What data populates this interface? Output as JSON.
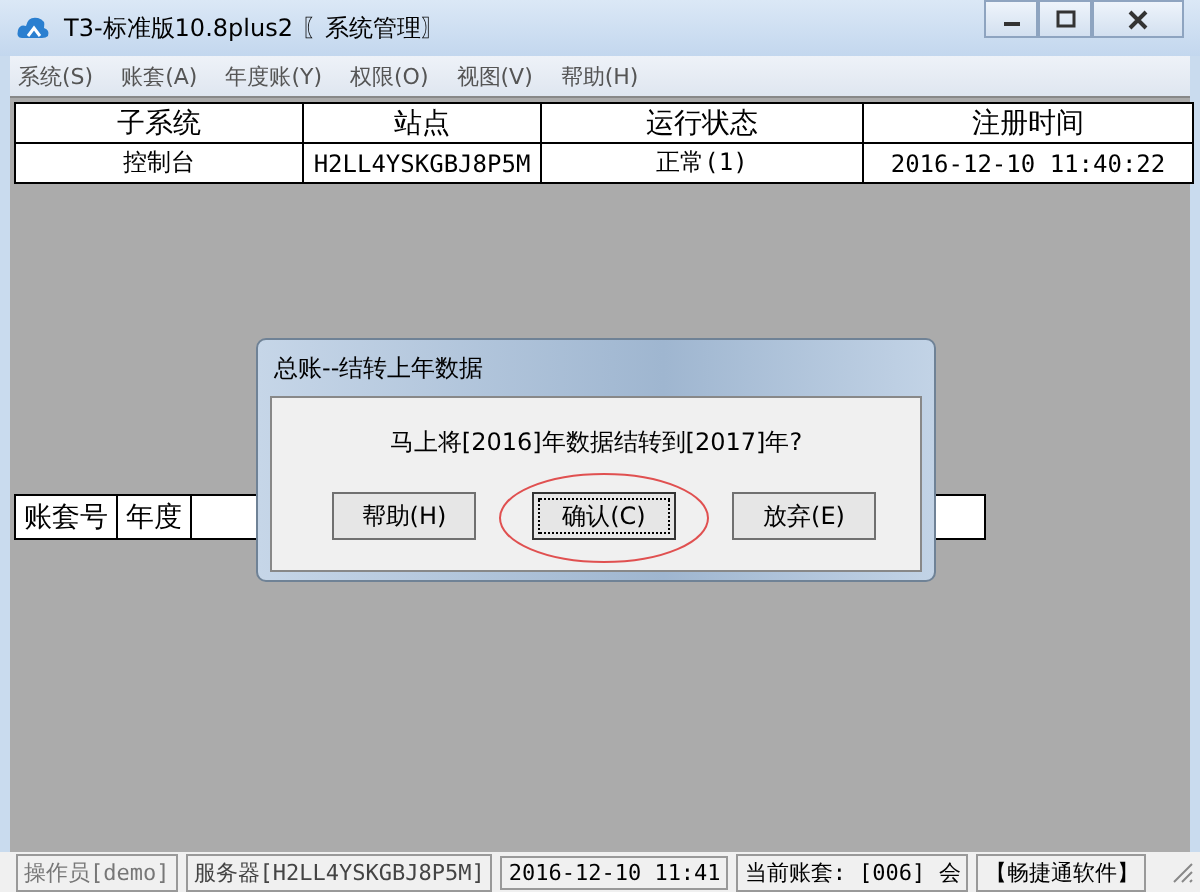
{
  "window": {
    "title": "T3-标准版10.8plus2 〖系统管理〗"
  },
  "menu": [
    "系统(S)",
    "账套(A)",
    "年度账(Y)",
    "权限(O)",
    "视图(V)",
    "帮助(H)"
  ],
  "top_table": {
    "columns": [
      "子系统",
      "站点",
      "运行状态",
      "注册时间"
    ],
    "rows": [
      [
        "控制台",
        "H2LL4YSKGBJ8P5M",
        "正常(1)",
        "2016-12-10 11:40:22"
      ]
    ]
  },
  "bottom_table": {
    "columns": [
      "账套号",
      "年度"
    ]
  },
  "dialog": {
    "title": "总账--结转上年数据",
    "message": "马上将[2016]年数据结转到[2017]年?",
    "buttons": [
      {
        "label": "帮助(H)",
        "focused": false
      },
      {
        "label": "确认(C)",
        "focused": true
      },
      {
        "label": "放弃(E)",
        "focused": false
      }
    ]
  },
  "status_bar": [
    "操作员[demo]",
    "服务器[H2LL4YSKGBJ8P5M]",
    "2016-12-10 11:41",
    "当前账套: [006] 会",
    "【畅捷通软件】"
  ]
}
